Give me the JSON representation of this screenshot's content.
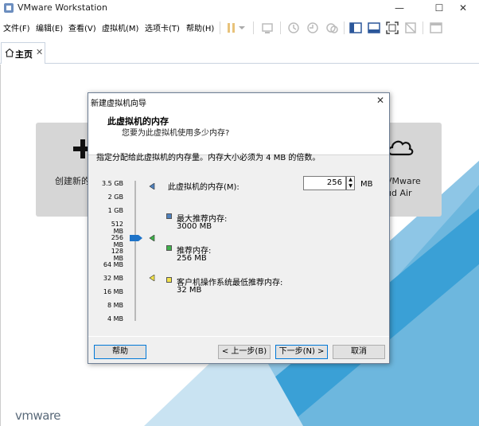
{
  "app": {
    "title": "VMware Workstation",
    "window_controls": {
      "minimize": "—",
      "maximize": "☐",
      "close": "✕"
    }
  },
  "menubar": {
    "items": [
      "文件(F)",
      "编辑(E)",
      "查看(V)",
      "虚拟机(M)",
      "选项卡(T)",
      "帮助(H)"
    ]
  },
  "tabs": {
    "home_label": "主页",
    "close_glyph": "✕"
  },
  "home": {
    "tile_create_label": "创建新的",
    "tile_connect_label": "VMware\nud Air",
    "logo_text": "vmware"
  },
  "dialog": {
    "title": "新建虚拟机向导",
    "close_glyph": "✕",
    "heading": "此虚拟机的内存",
    "subheading": "您要为此虚拟机使用多少内存?",
    "instruction": "指定分配给此虚拟机的内存量。内存大小必须为 4 MB 的倍数。",
    "scale_labels": [
      "3.5 GB",
      "2 GB",
      "1 GB",
      "512 MB",
      "256 MB",
      "128 MB",
      "64 MB",
      "32 MB",
      "16 MB",
      "8 MB",
      "4 MB"
    ],
    "memory_label": "此虚拟机的内存(M):",
    "memory_value": "256",
    "memory_unit": "MB",
    "legend": {
      "max": {
        "title": "最大推荐内存:",
        "value": "3000 MB",
        "color": "#4f81bd"
      },
      "recommended": {
        "title": "推荐内存:",
        "value": "256 MB",
        "color": "#3fb04a"
      },
      "guest_min": {
        "title": "客户机操作系统最低推荐内存:",
        "value": "32 MB",
        "color": "#f2e24a"
      }
    },
    "buttons": {
      "help": "帮助",
      "back": "< 上一步(B)",
      "next": "下一步(N) >",
      "cancel": "取消"
    }
  }
}
